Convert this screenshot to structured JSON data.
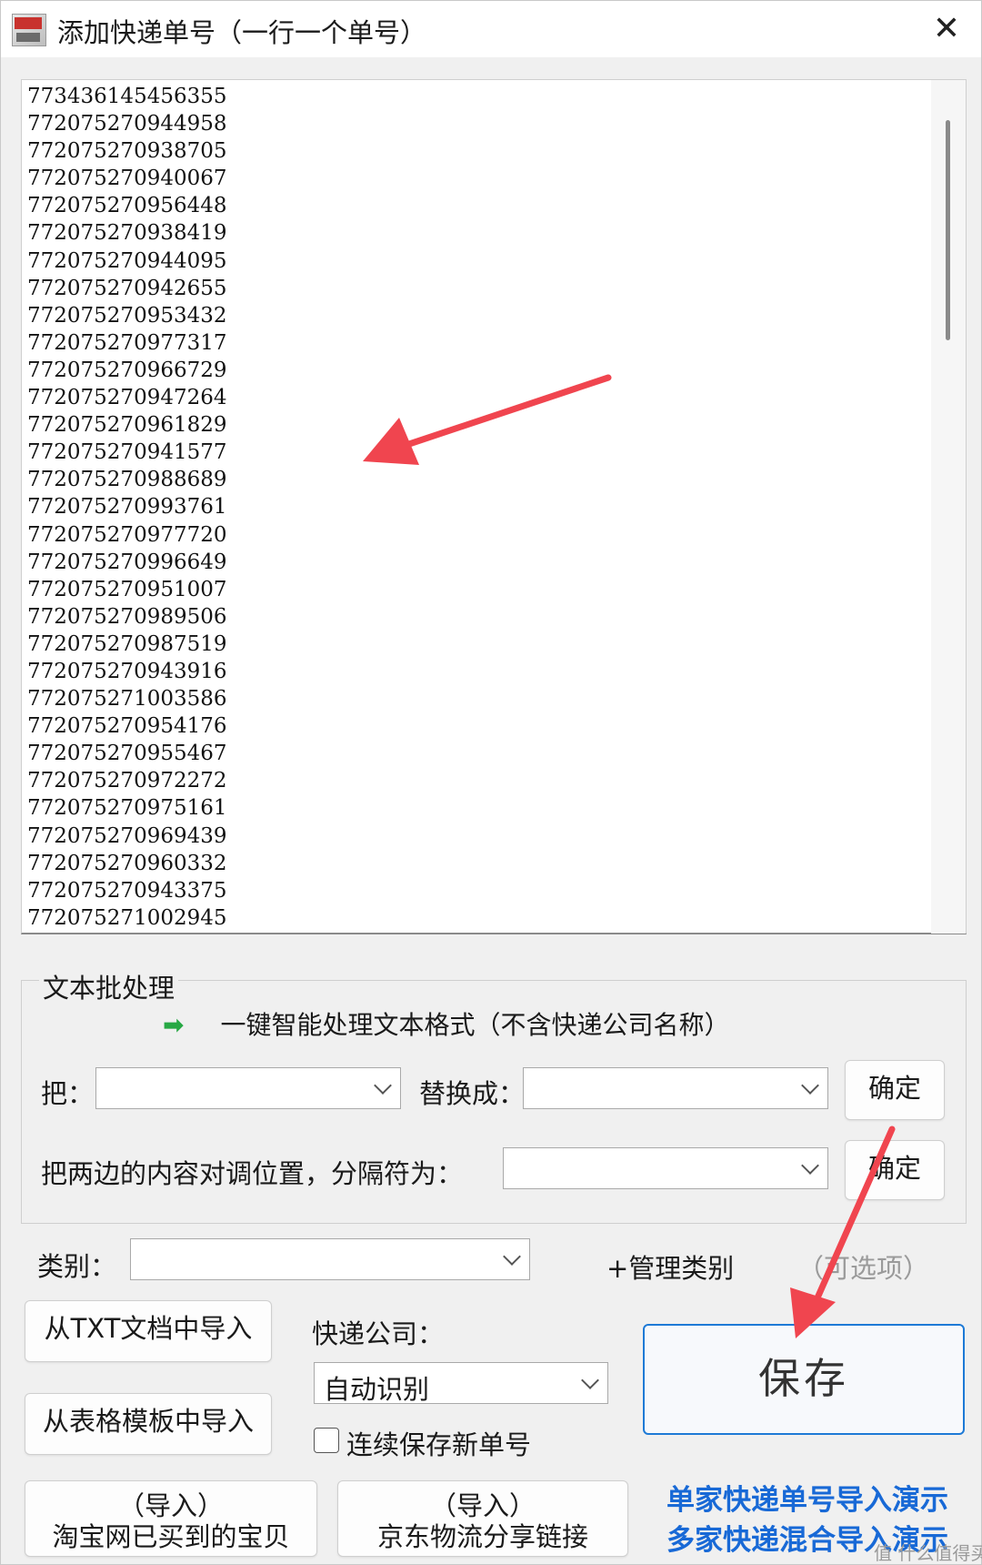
{
  "window": {
    "title": "添加快递单号（一行一个单号）",
    "close_glyph": "✕"
  },
  "tracking_numbers": [
    "773436145456355",
    "772075270944958",
    "772075270938705",
    "772075270940067",
    "772075270956448",
    "772075270938419",
    "772075270944095",
    "772075270942655",
    "772075270953432",
    "772075270977317",
    "772075270966729",
    "772075270947264",
    "772075270961829",
    "772075270941577",
    "772075270988689",
    "772075270993761",
    "772075270977720",
    "772075270996649",
    "772075270951007",
    "772075270989506",
    "772075270987519",
    "772075270943916",
    "772075271003586",
    "772075270954176",
    "772075270955467",
    "772075270972272",
    "772075270975161",
    "772075270969439",
    "772075270960332",
    "772075270943375",
    "772075271002945"
  ],
  "batch": {
    "group_label": "文本批处理",
    "smart_process": "一键智能处理文本格式（不含快递公司名称）",
    "replace_from_label": "把：",
    "replace_to_label": "替换成：",
    "confirm_1": "确定",
    "swap_label": "把两边的内容对调位置，分隔符为：",
    "confirm_2": "确定"
  },
  "category": {
    "label": "类别：",
    "manage": "+管理类别",
    "optional": "（可选项）"
  },
  "import": {
    "from_txt": "从TXT文档中导入",
    "from_template": "从表格模板中导入",
    "taobao_line1": "（导入）",
    "taobao_line2": "淘宝网已买到的宝贝",
    "jd_line1": "（导入）",
    "jd_line2": "京东物流分享链接"
  },
  "courier": {
    "label": "快递公司：",
    "selected": "自动识别",
    "continuous_save": "连续保存新单号"
  },
  "save_label": "保存",
  "links": {
    "single_demo": "单家快递单号导入演示",
    "multi_demo": "多家快递混合导入演示"
  },
  "watermark": "值 什么值得买",
  "colors": {
    "annotation_arrow": "#f0454f",
    "link": "#1869d6",
    "save_border": "#1e7ad6",
    "green_arrow": "#27a844"
  }
}
